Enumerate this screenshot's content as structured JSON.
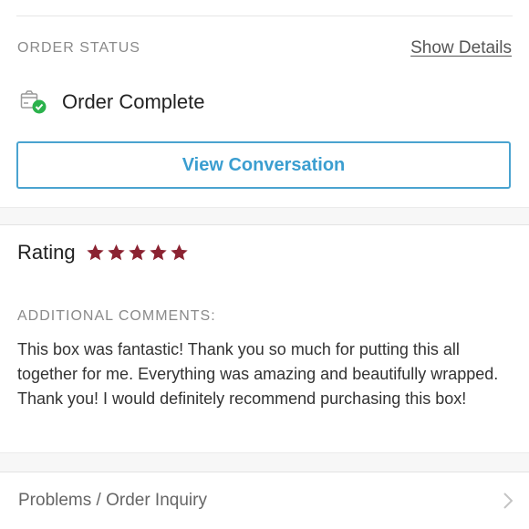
{
  "order_status": {
    "label": "ORDER STATUS",
    "show_details": "Show Details",
    "status_icon": "box-check-icon",
    "status_text": "Order Complete",
    "view_conversation": "View Conversation"
  },
  "rating": {
    "label": "Rating",
    "stars": 5,
    "max_stars": 5,
    "star_color": "#8b2332"
  },
  "comments": {
    "label": "ADDITIONAL COMMENTS:",
    "text": "This box was fantastic! Thank you so much for putting this all together for me. Everything was amazing and beautifully wrapped. Thank you! I would definitely recommend purchasing this box!"
  },
  "inquiry": {
    "label": "Problems / Order Inquiry",
    "icon": "chevron-right-icon"
  },
  "colors": {
    "accent": "#3b9ed0",
    "success": "#2bb24c"
  }
}
